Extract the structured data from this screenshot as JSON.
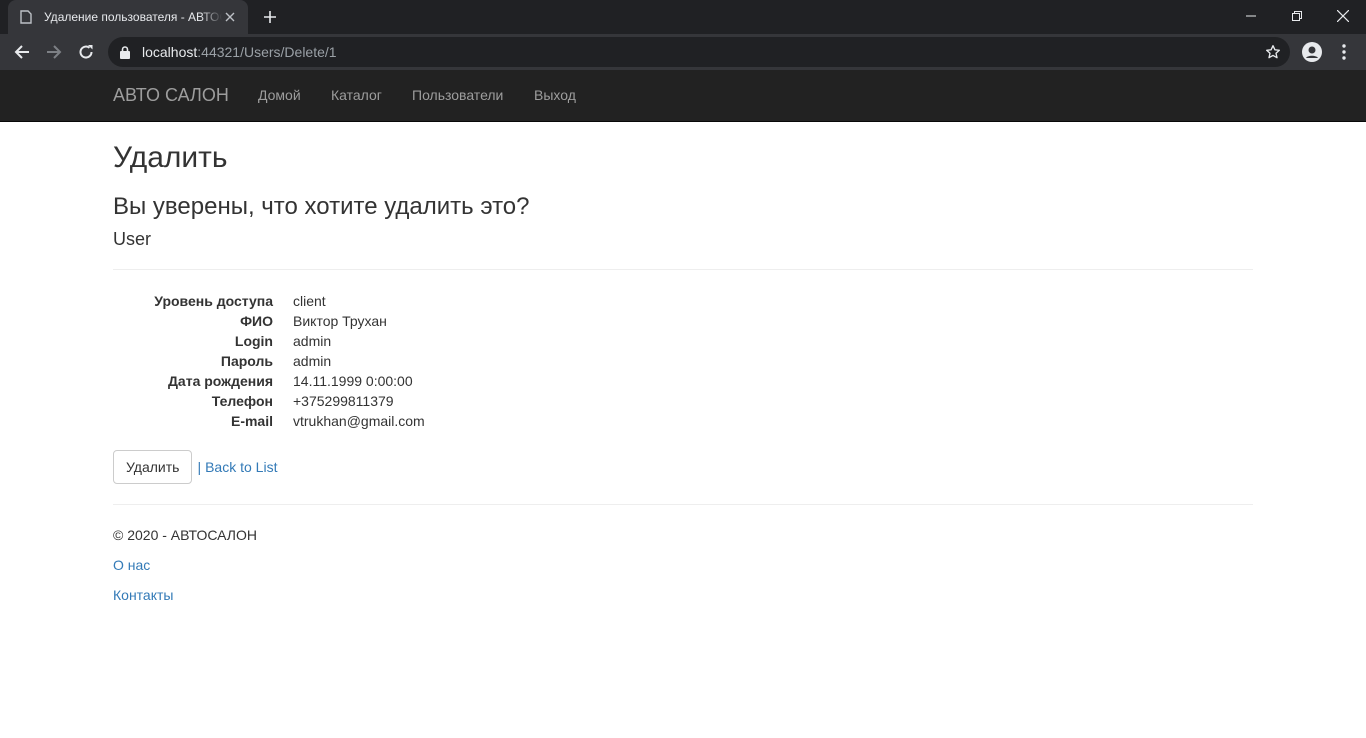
{
  "browser": {
    "tab_title": "Удаление пользователя - АВТОСАЛОН",
    "url_host": "localhost",
    "url_path": ":44321/Users/Delete/1"
  },
  "navbar": {
    "brand": "АВТО САЛОН",
    "links": [
      "Домой",
      "Каталог",
      "Пользователи",
      "Выход"
    ]
  },
  "page": {
    "title": "Удалить",
    "confirm": "Вы уверены, что хотите удалить это?",
    "entity": "User"
  },
  "details": [
    {
      "label": "Уровень доступа",
      "value": "client"
    },
    {
      "label": "ФИО",
      "value": "Виктор Трухан"
    },
    {
      "label": "Login",
      "value": "admin"
    },
    {
      "label": "Пароль",
      "value": "admin"
    },
    {
      "label": "Дата рождения",
      "value": "14.11.1999 0:00:00"
    },
    {
      "label": "Телефон",
      "value": "+375299811379"
    },
    {
      "label": "E-mail",
      "value": "vtrukhan@gmail.com"
    }
  ],
  "actions": {
    "delete_label": "Удалить",
    "separator": "|",
    "back_label": "Back to List"
  },
  "footer": {
    "copyright": "© 2020 - АВТОСАЛОН",
    "about": "О нас",
    "contacts": "Контакты"
  },
  "colors": {
    "navbar_bg": "#222222",
    "link": "#337ab7",
    "chrome_dark": "#202124",
    "chrome_toolbar": "#35363a"
  }
}
